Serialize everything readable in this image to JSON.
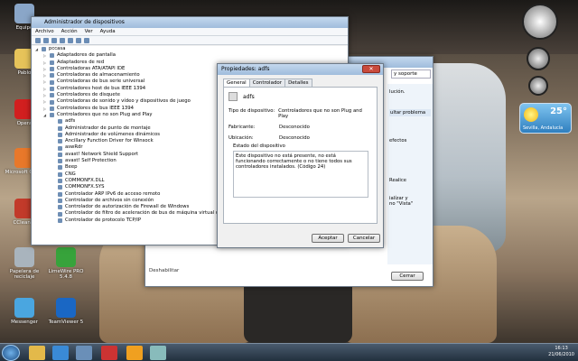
{
  "desktop": {
    "icons": [
      {
        "label": "Equipo",
        "color": "#8aa6c8"
      },
      {
        "label": "Pablo",
        "color": "#e6c35a"
      },
      {
        "label": "Opera",
        "color": "#d21f1f"
      },
      {
        "label": "Microsoft Office",
        "color": "#e8782a"
      },
      {
        "label": "CCleaner",
        "color": "#c23a2a"
      },
      {
        "label": "Papelera de reciclaje",
        "color": "#a9b4bd"
      },
      {
        "label": "Messenger",
        "color": "#4aa6e0"
      },
      {
        "label": "LimeWire PRO 5.4.8",
        "color": "#37a33b"
      },
      {
        "label": "TeamViewer 5",
        "color": "#1a67c4"
      }
    ]
  },
  "devmgr": {
    "title": "Administrador de dispositivos",
    "menu": [
      "Archivo",
      "Acción",
      "Ver",
      "Ayuda"
    ],
    "tree": [
      {
        "label": "pccasa",
        "level": 0,
        "expander": "◢"
      },
      {
        "label": "Adaptadores de pantalla",
        "level": 1,
        "expander": "▷"
      },
      {
        "label": "Adaptadores de red",
        "level": 1,
        "expander": "▷"
      },
      {
        "label": "Controladoras ATA/ATAPI IDE",
        "level": 1,
        "expander": "▷"
      },
      {
        "label": "Controladoras de almacenamiento",
        "level": 1,
        "expander": "▷"
      },
      {
        "label": "Controladoras de bus serie universal",
        "level": 1,
        "expander": "▷"
      },
      {
        "label": "Controladores host de bus IEEE 1394",
        "level": 1,
        "expander": "▷"
      },
      {
        "label": "Controladores de disquete",
        "level": 1,
        "expander": "▷"
      },
      {
        "label": "Controladoras de sonido y vídeo y dispositivos de juego",
        "level": 1,
        "expander": "▷"
      },
      {
        "label": "Controladores de bus IEEE 1394",
        "level": 1,
        "expander": "▷"
      },
      {
        "label": "Controladores que no son Plug and Play",
        "level": 1,
        "expander": "◢"
      },
      {
        "label": "adfs",
        "level": 2,
        "expander": ""
      },
      {
        "label": "Administrador de punto de montaje",
        "level": 2,
        "expander": ""
      },
      {
        "label": "Administrador de volúmenes dinámicos",
        "level": 2,
        "expander": ""
      },
      {
        "label": "Ancillary Function Driver for Winsock",
        "level": 2,
        "expander": ""
      },
      {
        "label": "aswRdr",
        "level": 2,
        "expander": ""
      },
      {
        "label": "avast! Network Shield Support",
        "level": 2,
        "expander": ""
      },
      {
        "label": "avast! Self Protection",
        "level": 2,
        "expander": ""
      },
      {
        "label": "Beep",
        "level": 2,
        "expander": ""
      },
      {
        "label": "CNG",
        "level": 2,
        "expander": ""
      },
      {
        "label": "COMMONFX.DLL",
        "level": 2,
        "expander": ""
      },
      {
        "label": "COMMONFX.SYS",
        "level": 2,
        "expander": ""
      },
      {
        "label": "Controlador ARP IPv6 de acceso remoto",
        "level": 2,
        "expander": ""
      },
      {
        "label": "Controlador de archivos sin conexión",
        "level": 2,
        "expander": ""
      },
      {
        "label": "Controlador de autorización de Firewall de Windows",
        "level": 2,
        "expander": ""
      },
      {
        "label": "Controlador de filtro de aceleración de bus de máquina virtual de disco",
        "level": 2,
        "expander": ""
      },
      {
        "label": "Controlador de protocolo TCP/IP",
        "level": 2,
        "expander": ""
      }
    ]
  },
  "props": {
    "title": "Propiedades: adfs",
    "tabs": [
      "General",
      "Controlador",
      "Detalles"
    ],
    "device_name": "adfs",
    "rows": [
      {
        "k": "Tipo de dispositivo:",
        "v": "Controladores que no son Plug and Play"
      },
      {
        "k": "Fabricante:",
        "v": "Desconocido"
      },
      {
        "k": "Ubicación:",
        "v": "Desconocido"
      }
    ],
    "status_label": "Estado del dispositivo",
    "status_text": "Este dispositivo no está presente, no está funcionando correctamente o no tiene todos sus controladores instalados. (Código 24)",
    "ok": "Aceptar",
    "cancel": "Cancelar"
  },
  "backwin": {
    "search_hint": "y soporte",
    "lines": [
      "lución.",
      "ultar problema",
      "efectos",
      "Realice",
      "ialízar y",
      "no \"Vista\"",
      "Deshabilitar"
    ],
    "close_btn": "Cerrar"
  },
  "weather": {
    "temp": "25°",
    "place": "Sevilla, Andalucía"
  },
  "clock": {
    "time": "16:13",
    "date": "21/06/2010"
  }
}
